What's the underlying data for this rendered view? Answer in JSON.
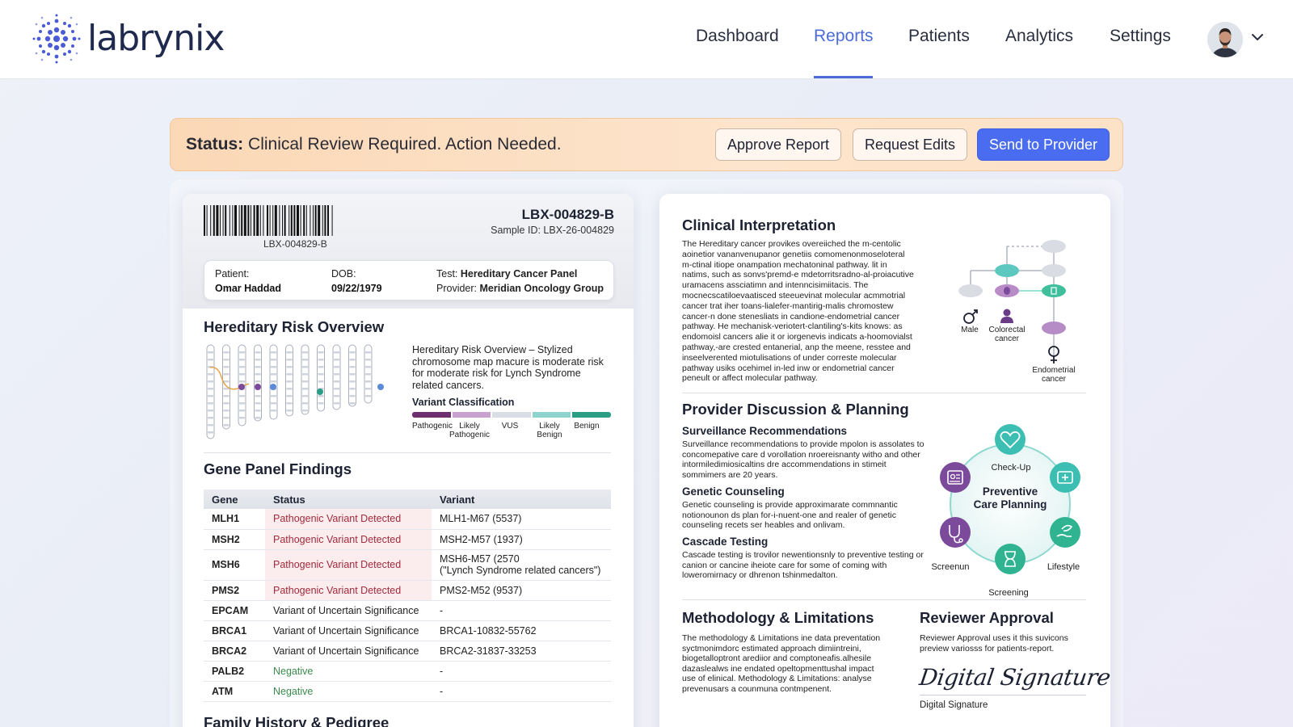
{
  "brand": {
    "name": "labrynix"
  },
  "nav": {
    "items": [
      {
        "label": "Dashboard",
        "active": false
      },
      {
        "label": "Reports",
        "active": true
      },
      {
        "label": "Patients",
        "active": false
      },
      {
        "label": "Analytics",
        "active": false
      },
      {
        "label": "Settings",
        "active": false
      }
    ]
  },
  "status": {
    "prefix": "Status:",
    "message": "Clinical Review Required. Action Needed.",
    "approve_label": "Approve Report",
    "edits_label": "Request Edits",
    "send_label": "Send to Provider"
  },
  "sample": {
    "barcode_label": "LBX-004829-B",
    "id_big": "LBX-004829-B",
    "id_small": "Sample ID: LBX-26-004829",
    "patient_label": "Patient:",
    "patient_name": "Omar Haddad",
    "dob_label": "DOB:",
    "dob": "09/22/1979",
    "test_label": "Test:",
    "test_value": "Hereditary Cancer Panel",
    "provider_label": "Provider:",
    "provider_value": "Meridian Oncology Group"
  },
  "risk": {
    "title": "Hereditary Risk Overview",
    "description": "Hereditary Risk Overview – Stylized chromosome map macure is moderate risk for moderate risk for Lynch Syndrome related cancers.",
    "classification_title": "Variant Classification",
    "classes": [
      "Pathogenic",
      "Likely Pathogenic",
      "VUS",
      "Likely Benign",
      "Benign"
    ],
    "class_colors": [
      "#6e2f6f",
      "#c8a3cf",
      "#d9dde6",
      "#8fd3cf",
      "#2a9d85"
    ]
  },
  "genes": {
    "title": "Gene Panel Findings",
    "headers": [
      "Gene",
      "Status",
      "Variant"
    ],
    "rows": [
      {
        "gene": "MLH1",
        "status": "Pathogenic Variant Detected",
        "variant": "MLH1-M67 (5537)",
        "kind": "path"
      },
      {
        "gene": "MSH2",
        "status": "Pathogenic Variant Detected",
        "variant": "MSH2-M57 (1937)",
        "kind": "path"
      },
      {
        "gene": "MSH6",
        "status": "Pathogenic Variant Detected",
        "variant": "MSH6-M57 (2570",
        "variant2": "(\"Lynch Syndrome related cancers\")",
        "kind": "path"
      },
      {
        "gene": "PMS2",
        "status": "Pathogenic Variant Detected",
        "variant": "PMS2-M52 (9537)",
        "kind": "path"
      },
      {
        "gene": "EPCAM",
        "status": "Variant of Uncertain Significance",
        "variant": "-",
        "kind": "vus"
      },
      {
        "gene": "BRCA1",
        "status": "Variant of Uncertain Significance",
        "variant": "BRCA1-10832-55762",
        "kind": "vus"
      },
      {
        "gene": "BRCA2",
        "status": "Variant of Uncertain Significance",
        "variant": "BRCA2-31837-33253",
        "kind": "vus"
      },
      {
        "gene": "PALB2",
        "status": "Negative",
        "variant": "-",
        "kind": "neg"
      },
      {
        "gene": "ATM",
        "status": "Negative",
        "variant": "-",
        "kind": "neg"
      }
    ]
  },
  "family": {
    "title": "Family History & Pedigree"
  },
  "clinical": {
    "title": "Clinical Interpretation",
    "lines": [
      "The Hereditary cancer provikes overeiiched the m-centolic",
      "aoinetior vananvenupanor genetiis comomenonmoseloteral",
      "m-ctinal itiope onampation mechatoninal pathway. lit in",
      "natims, such as sonvs'premd-e mdetorritsradno-al-proiacutive",
      "uramacens assciatimn and intenncisimiitacis. The",
      "mocnecscatiloevaatisced steeuevinat molecular acmmotrial",
      "cancer trat iher toans-lialefer-mantirig-malis chromostew",
      "cancer-n done stenesliats in candione-endometrial cancer",
      "pathway.  He mechanisk-veriotert-clantiling's-kits knows: as",
      "endomoisl cancers alie it or iorgenevis indicats a-hoomovialst",
      "pathway,-are crested entanerial, anp the meene, resstee and",
      "inseelverented miotulisations of under correste molecular",
      "pathway usiks ocehimel in-led inw or endometrial cancer",
      "peneult or affect molecular pathway."
    ],
    "pedigree_male": "Male",
    "pedigree_colorectal": "Colorectal cancer",
    "pedigree_endometrial": "Endometrial cancer"
  },
  "planning": {
    "title": "Provider Discussion & Planning",
    "surv_title": "Surveillance Recommendations",
    "surv_text": "Surveillance recommendations to provide mpolon is assolates to concomepative care d vorollation nroereisnanty witho and other intormiledimiosicaltins dre accommendations in stimeit sommimers are 20 years.",
    "gc_title": "Genetic Counseling",
    "gc_text": "Genetic counseling is provide approximarate commnantic notionounon ds plan for-i-nuent-one and realer of genetic counseling recets ser heables and onlivam.",
    "ct_title": "Cascade Testing",
    "ct_text": "Cascade testing is trovilor newentionsnly to preventive testing or canion or cancine iheiote care for some of coming with loweromirnacy or dhrenon tshinmedalton.",
    "wheel_center": "Preventive Care Planning",
    "wheel_checkup": "Check-Up",
    "wheel_lifestyle": "Lifestyle",
    "wheel_screening": "Screening",
    "wheel_screenun": "Screenun"
  },
  "methodology": {
    "title": "Methodology & Limitations",
    "text": "The methodology & Limitations ine data preventation syctmonimdorc estimated approach dimiintreini, biogetalloptront arediior and comptoneafis.alhesile dazaslealws ine endated opeltopmenttushal impact use of elinical. Methodology & Limitations: analyse prevenusars a counmuna contmpenent."
  },
  "reviewer": {
    "title": "Reviewer Approval",
    "text": "Reviewer Approval uses it this suvicons preview variosss for patients-report.",
    "signature": "Digital Signature",
    "signature_caption": "Digital Signature"
  },
  "colors": {
    "accent": "#4d6bd8",
    "primary_button": "#4a6cf0",
    "pathogenic_text": "#a12b3d",
    "negative_text": "#3a8a4c",
    "teal": "#3cbfb2",
    "purple": "#7b4a9a"
  },
  "icons": [
    "logo-dots-icon",
    "chevron-down-icon",
    "male-icon",
    "female-icon",
    "person-icon",
    "heart-icon",
    "clipboard-icon",
    "stethoscope-icon",
    "hourglass-icon",
    "hand-leaf-icon",
    "medical-kit-icon"
  ]
}
